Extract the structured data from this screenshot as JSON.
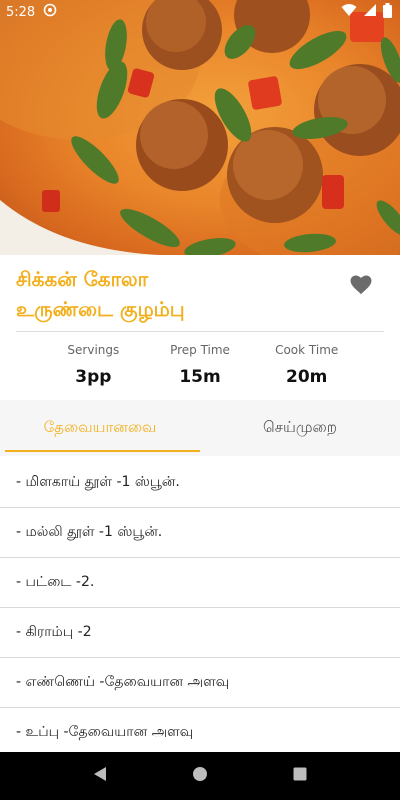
{
  "status_bar": {
    "time": "5:28",
    "icons": [
      "notification-icon",
      "wifi-icon",
      "signal-icon",
      "battery-icon"
    ]
  },
  "recipe": {
    "title_line1": "சிக்கன் கோலா",
    "title_line2": "உருண்டை குழம்பு",
    "favorite_icon": "heart-icon"
  },
  "stats": [
    {
      "label": "Servings",
      "value": "3pp"
    },
    {
      "label": "Prep Time",
      "value": "15m"
    },
    {
      "label": "Cook Time",
      "value": "20m"
    }
  ],
  "tabs": [
    {
      "label": "தேவையானவை",
      "active": true
    },
    {
      "label": "செய்முறை",
      "active": false
    }
  ],
  "ingredients": [
    "- மிளகாய் தூள் -1 ஸ்பூன்.",
    "- மல்லி தூள் -1 ஸ்பூன்.",
    "- பட்டை -2.",
    "- கிராம்பு -2",
    "- எண்ணெய் -தேவையான அளவு",
    "- உப்பு -தேவையான அளவு"
  ],
  "nav_bar": {
    "icons": [
      "back-icon",
      "home-icon",
      "recents-icon"
    ]
  },
  "colors": {
    "accent": "#f2b01e",
    "tab_background": "#f6f6f6",
    "divider": "#d9d9d9",
    "nav_background": "#000000"
  }
}
